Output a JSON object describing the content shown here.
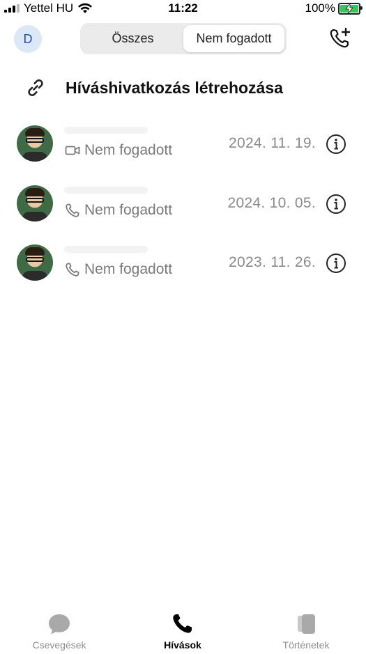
{
  "status_bar": {
    "carrier": "Yettel HU",
    "time": "11:22",
    "battery": "100%"
  },
  "header": {
    "profile_initial": "D",
    "segments": [
      "Összes",
      "Nem fogadott"
    ],
    "active_segment": "Nem fogadott"
  },
  "call_link": {
    "label": "Híváshivatkozás létrehozása"
  },
  "calls": [
    {
      "type_icon": "video-camera-icon",
      "status": "Nem fogadott",
      "date": "2024. 11. 19."
    },
    {
      "type_icon": "phone-icon",
      "status": "Nem fogadott",
      "date": "2024. 10. 05."
    },
    {
      "type_icon": "phone-icon",
      "status": "Nem fogadott",
      "date": "2023. 11. 26."
    }
  ],
  "tabbar": {
    "tabs": [
      {
        "label": "Csevegések",
        "icon": "chat-bubble-icon"
      },
      {
        "label": "Hívások",
        "icon": "phone-icon",
        "active": true
      },
      {
        "label": "Történetek",
        "icon": "stories-icon"
      }
    ]
  },
  "colors": {
    "battery_green": "#35c759",
    "avatar_bg": "#dde8f7",
    "avatar_text": "#1f4fa8",
    "muted_text": "#7a7a7a"
  }
}
